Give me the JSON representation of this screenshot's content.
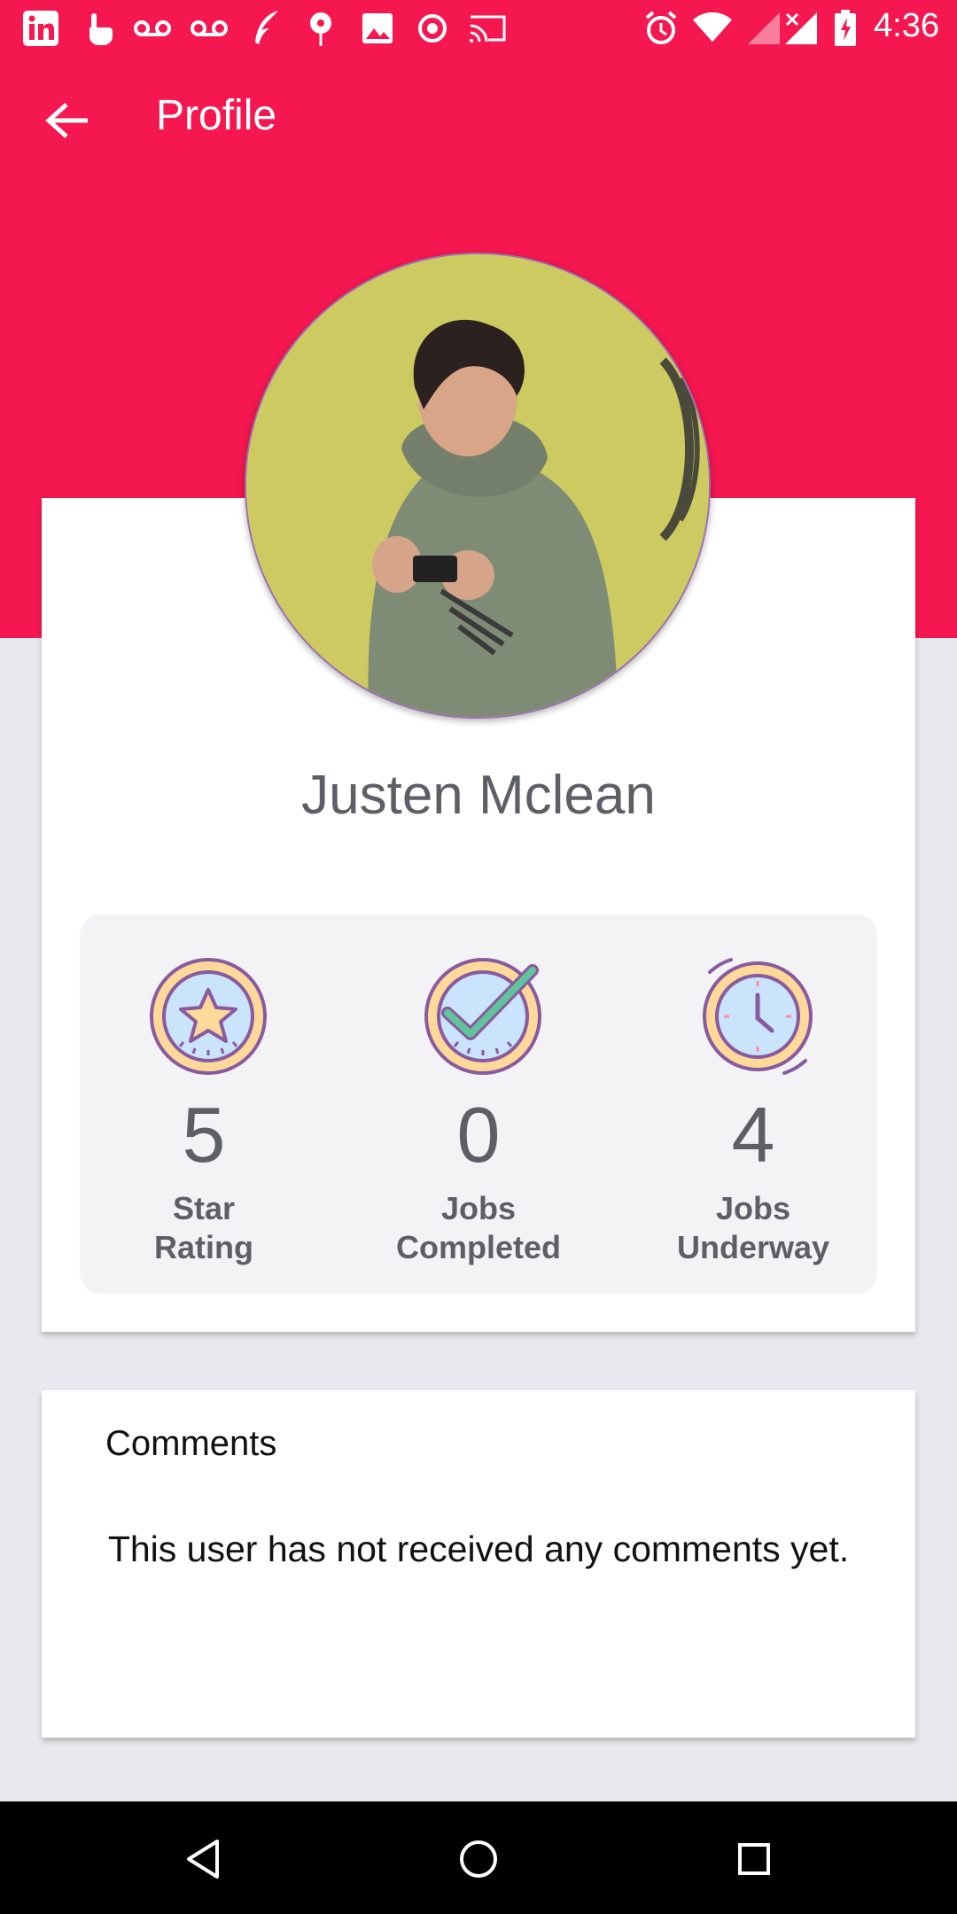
{
  "status_bar": {
    "time": "4:36",
    "left_icons": [
      "linkedin-icon",
      "touch-icon",
      "voicemail-icon",
      "voicemail-icon",
      "feather-icon",
      "flower-icon",
      "image-icon",
      "record-icon",
      "cast-icon"
    ],
    "right_icons": [
      "alarm-icon",
      "wifi-icon",
      "signal-icon",
      "no-signal-icon",
      "battery-charging-icon"
    ]
  },
  "app_bar": {
    "title": "Profile",
    "back_icon": "arrow-back-icon"
  },
  "colors": {
    "primary": "#f5174f",
    "background": "#e9e8ee",
    "card": "#ffffff",
    "stats_panel": "#f3f3f5",
    "text_secondary": "#5c5f66"
  },
  "profile": {
    "name": "Justen Mclean",
    "stats": [
      {
        "icon": "star-badge-icon",
        "value": "5",
        "label_line1": "Star",
        "label_line2": "Rating"
      },
      {
        "icon": "check-badge-icon",
        "value": "0",
        "label_line1": "Jobs",
        "label_line2": "Completed"
      },
      {
        "icon": "clock-badge-icon",
        "value": "4",
        "label_line1": "Jobs",
        "label_line2": "Underway"
      }
    ]
  },
  "comments": {
    "title": "Comments",
    "empty_message": "This user has not received any comments yet."
  },
  "nav_bar": {
    "buttons": [
      "back-triangle-icon",
      "home-circle-icon",
      "recents-square-icon"
    ]
  }
}
